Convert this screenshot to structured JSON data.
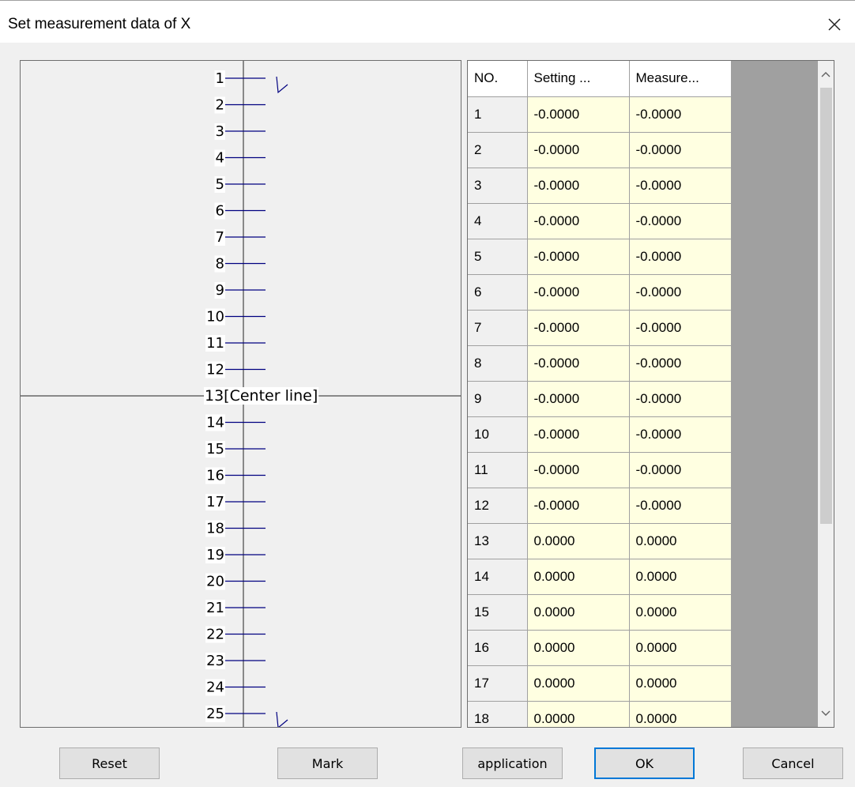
{
  "window": {
    "title": "Set measurement data of  X"
  },
  "diagram": {
    "points": [
      "1",
      "2",
      "3",
      "4",
      "5",
      "6",
      "7",
      "8",
      "9",
      "10",
      "11",
      "12",
      "13",
      "14",
      "15",
      "16",
      "17",
      "18",
      "19",
      "20",
      "21",
      "22",
      "23",
      "24",
      "25"
    ],
    "center_index": 13,
    "center_label": "[Center line]"
  },
  "table": {
    "headers": [
      "NO.",
      "Setting ...",
      "Measure..."
    ],
    "rows": [
      {
        "no": "1",
        "setting": "-0.0000",
        "measure": "-0.0000"
      },
      {
        "no": "2",
        "setting": "-0.0000",
        "measure": "-0.0000"
      },
      {
        "no": "3",
        "setting": "-0.0000",
        "measure": "-0.0000"
      },
      {
        "no": "4",
        "setting": "-0.0000",
        "measure": "-0.0000"
      },
      {
        "no": "5",
        "setting": "-0.0000",
        "measure": "-0.0000"
      },
      {
        "no": "6",
        "setting": "-0.0000",
        "measure": "-0.0000"
      },
      {
        "no": "7",
        "setting": "-0.0000",
        "measure": "-0.0000"
      },
      {
        "no": "8",
        "setting": "-0.0000",
        "measure": "-0.0000"
      },
      {
        "no": "9",
        "setting": "-0.0000",
        "measure": "-0.0000"
      },
      {
        "no": "10",
        "setting": "-0.0000",
        "measure": "-0.0000"
      },
      {
        "no": "11",
        "setting": "-0.0000",
        "measure": "-0.0000"
      },
      {
        "no": "12",
        "setting": "-0.0000",
        "measure": "-0.0000"
      },
      {
        "no": "13",
        "setting": "0.0000",
        "measure": "0.0000"
      },
      {
        "no": "14",
        "setting": "0.0000",
        "measure": "0.0000"
      },
      {
        "no": "15",
        "setting": "0.0000",
        "measure": "0.0000"
      },
      {
        "no": "16",
        "setting": "0.0000",
        "measure": "0.0000"
      },
      {
        "no": "17",
        "setting": "0.0000",
        "measure": "0.0000"
      },
      {
        "no": "18",
        "setting": "0.0000",
        "measure": "0.0000"
      }
    ]
  },
  "buttons": {
    "reset": "Reset",
    "mark": "Mark",
    "application": "application",
    "ok": "OK",
    "cancel": "Cancel"
  },
  "icons": {
    "close": "close-icon",
    "scroll_up": "chevron-up-icon",
    "scroll_down": "chevron-down-icon",
    "marker": "tick-marker-icon"
  },
  "colors": {
    "value_cell_bg": "#ffffe1",
    "diagram_line": "#000080",
    "default_button_border": "#0078d7",
    "grid_bg": "#a0a0a0"
  }
}
